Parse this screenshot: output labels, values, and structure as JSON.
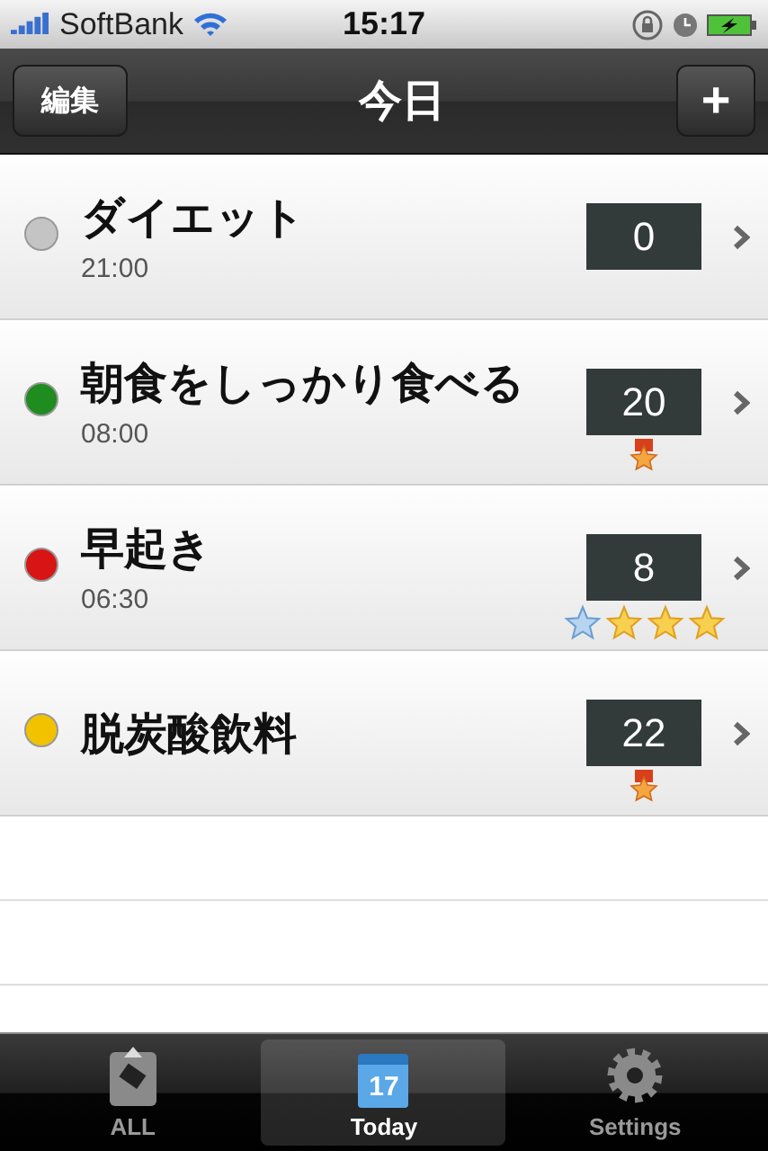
{
  "status_bar": {
    "carrier": "SoftBank",
    "time": "15:17"
  },
  "nav_bar": {
    "title": "今日",
    "left_button": "編集",
    "right_button": "+"
  },
  "rows": [
    {
      "name": "ダイエット",
      "time": "21:00",
      "count": "0",
      "color": "#c4c4c4",
      "badges": []
    },
    {
      "name": "朝食をしっかり食べる",
      "time": "08:00",
      "count": "20",
      "color": "#1e8c1e",
      "badges": [
        {
          "kind": "medal"
        }
      ]
    },
    {
      "name": "早起き",
      "time": "06:30",
      "count": "8",
      "color": "#d81414",
      "badges": [
        {
          "kind": "blue-star"
        },
        {
          "kind": "gold-star"
        },
        {
          "kind": "gold-star"
        },
        {
          "kind": "gold-star"
        }
      ]
    },
    {
      "name": "脱炭酸飲料",
      "count": "22",
      "color": "#f2c200",
      "badges": [
        {
          "kind": "medal"
        }
      ]
    }
  ],
  "tab_bar": [
    {
      "label": "ALL",
      "kind": "clipboard",
      "selected": false
    },
    {
      "label": "Today",
      "kind": "calendar",
      "icon_text": "17",
      "selected": true
    },
    {
      "label": "Settings",
      "kind": "gear",
      "selected": false
    }
  ]
}
